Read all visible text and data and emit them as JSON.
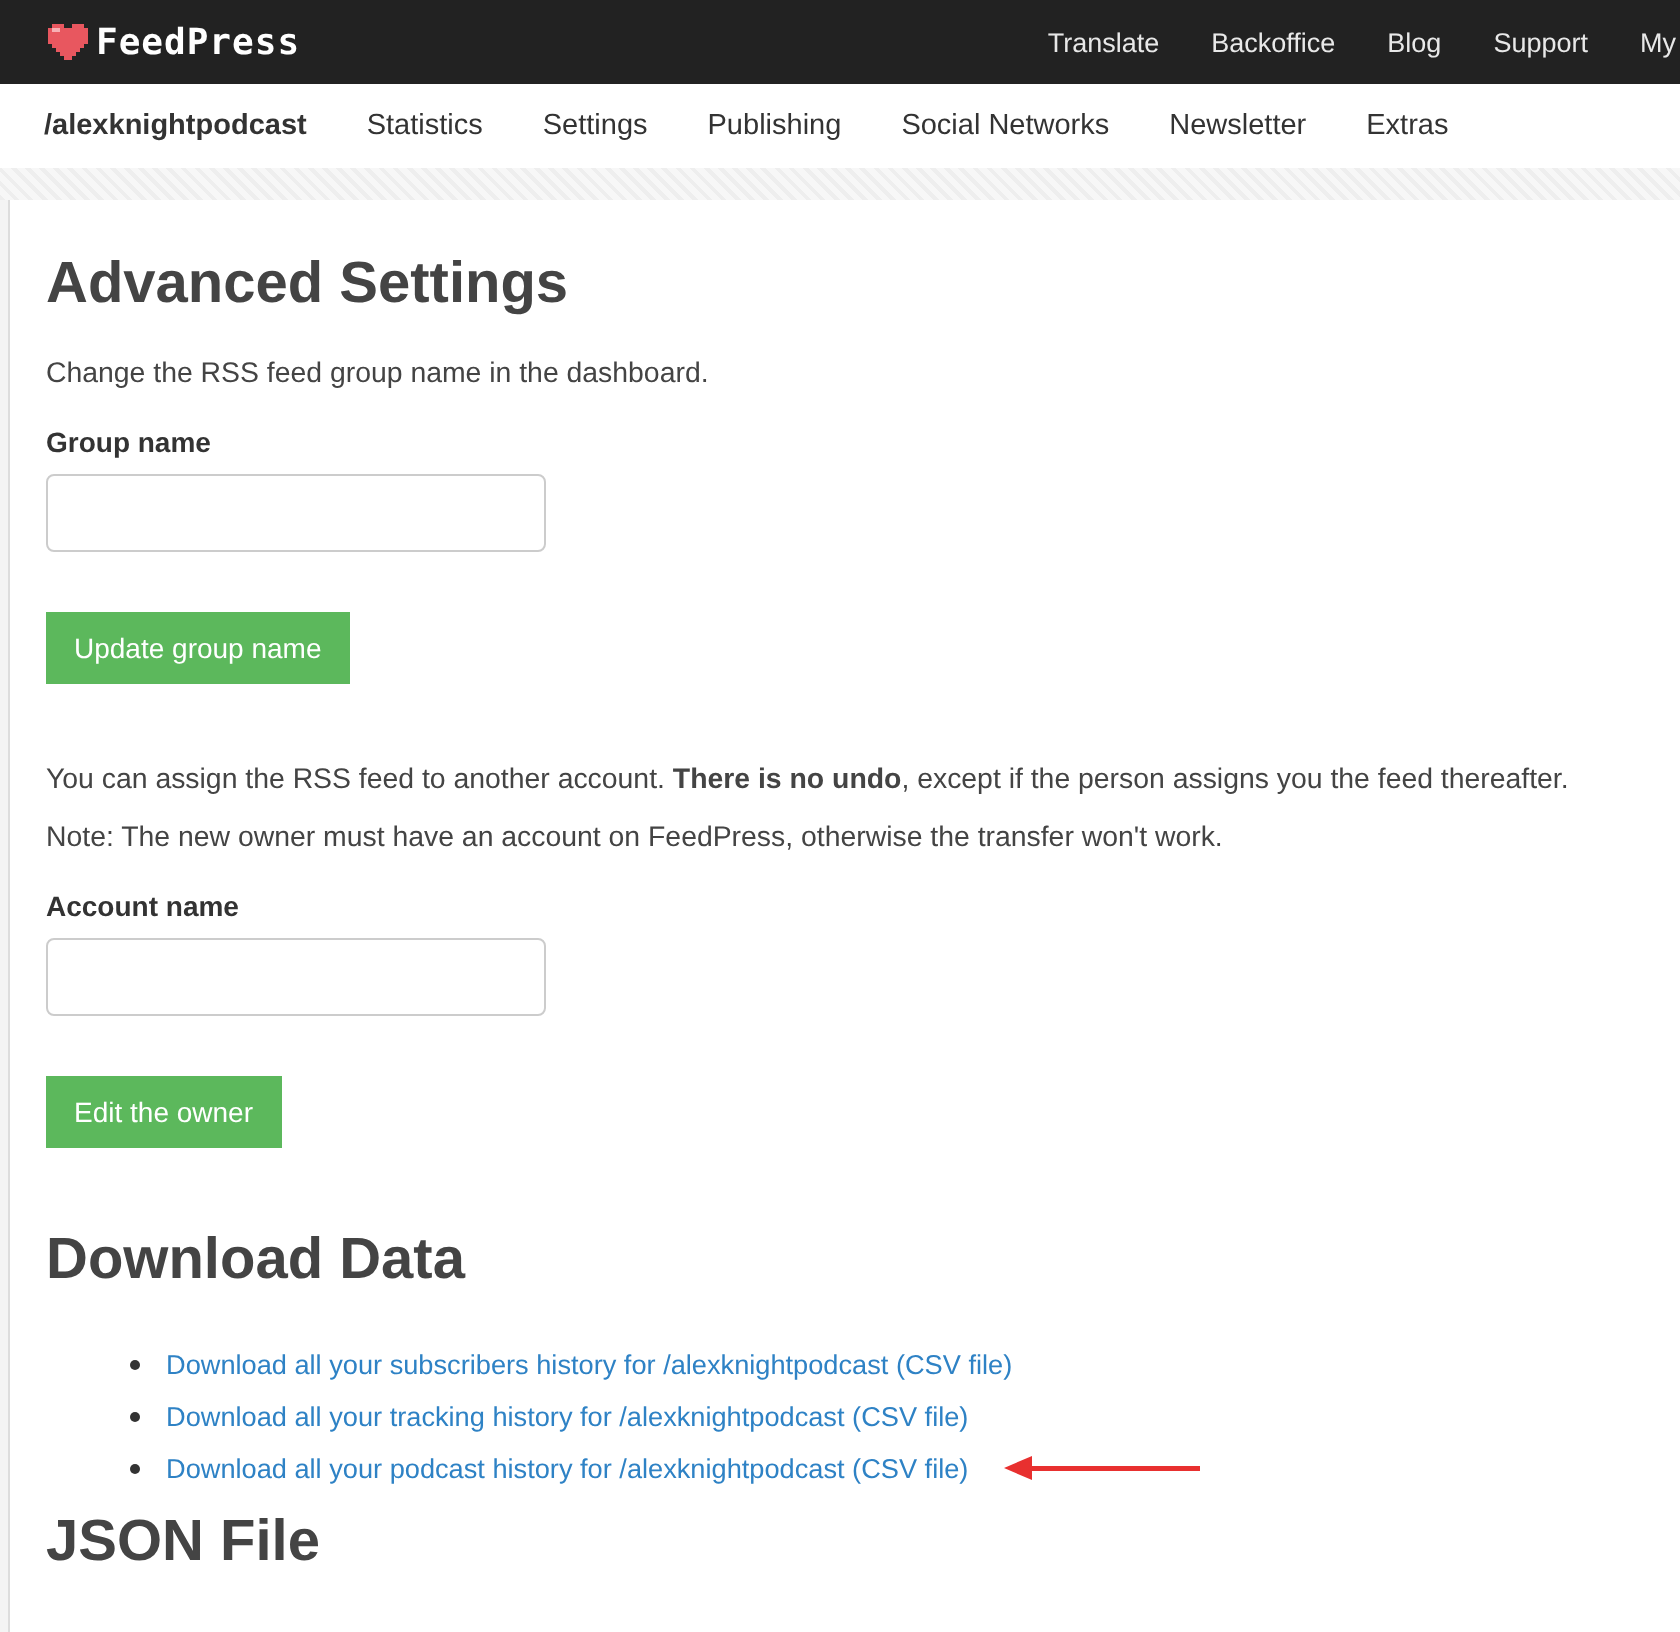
{
  "topbar": {
    "logo": "FeedPress",
    "links": [
      "Translate",
      "Backoffice",
      "Blog",
      "Support",
      "My"
    ]
  },
  "subnav": {
    "items": [
      {
        "label": "/alexknightpodcast",
        "selected": true
      },
      {
        "label": "Statistics",
        "selected": false
      },
      {
        "label": "Settings",
        "selected": false
      },
      {
        "label": "Publishing",
        "selected": false
      },
      {
        "label": "Social Networks",
        "selected": false
      },
      {
        "label": "Newsletter",
        "selected": false
      },
      {
        "label": "Extras",
        "selected": false
      }
    ]
  },
  "content": [
    {
      "kind": "h1",
      "text": "Advanced Settings"
    },
    {
      "kind": "p",
      "text": "Change the RSS feed group name in the dashboard."
    },
    {
      "kind": "field",
      "label": "Group name"
    },
    {
      "kind": "button",
      "text": "Update group name"
    },
    {
      "kind": "p",
      "text": "You can assign the RSS feed to another account. **There is no undo**, except if the person assigns you the feed thereafter."
    },
    {
      "kind": "p",
      "text": "Note: The new owner must have an account on FeedPress, otherwise the transfer won't work."
    },
    {
      "kind": "field",
      "label": "Account name"
    },
    {
      "kind": "button",
      "text": "Edit the owner"
    },
    {
      "kind": "h2",
      "text": "Download Data"
    },
    {
      "kind": "links",
      "items": [
        {
          "text": "Download all your subscribers history for /alexknightpodcast (CSV file)",
          "arrow": false
        },
        {
          "text": "Download all your tracking history for /alexknightpodcast (CSV file)",
          "arrow": false
        },
        {
          "text": "Download all your podcast history for /alexknightpodcast (CSV file)",
          "arrow": true
        }
      ]
    },
    {
      "kind": "h2",
      "text": "JSON File"
    }
  ]
}
